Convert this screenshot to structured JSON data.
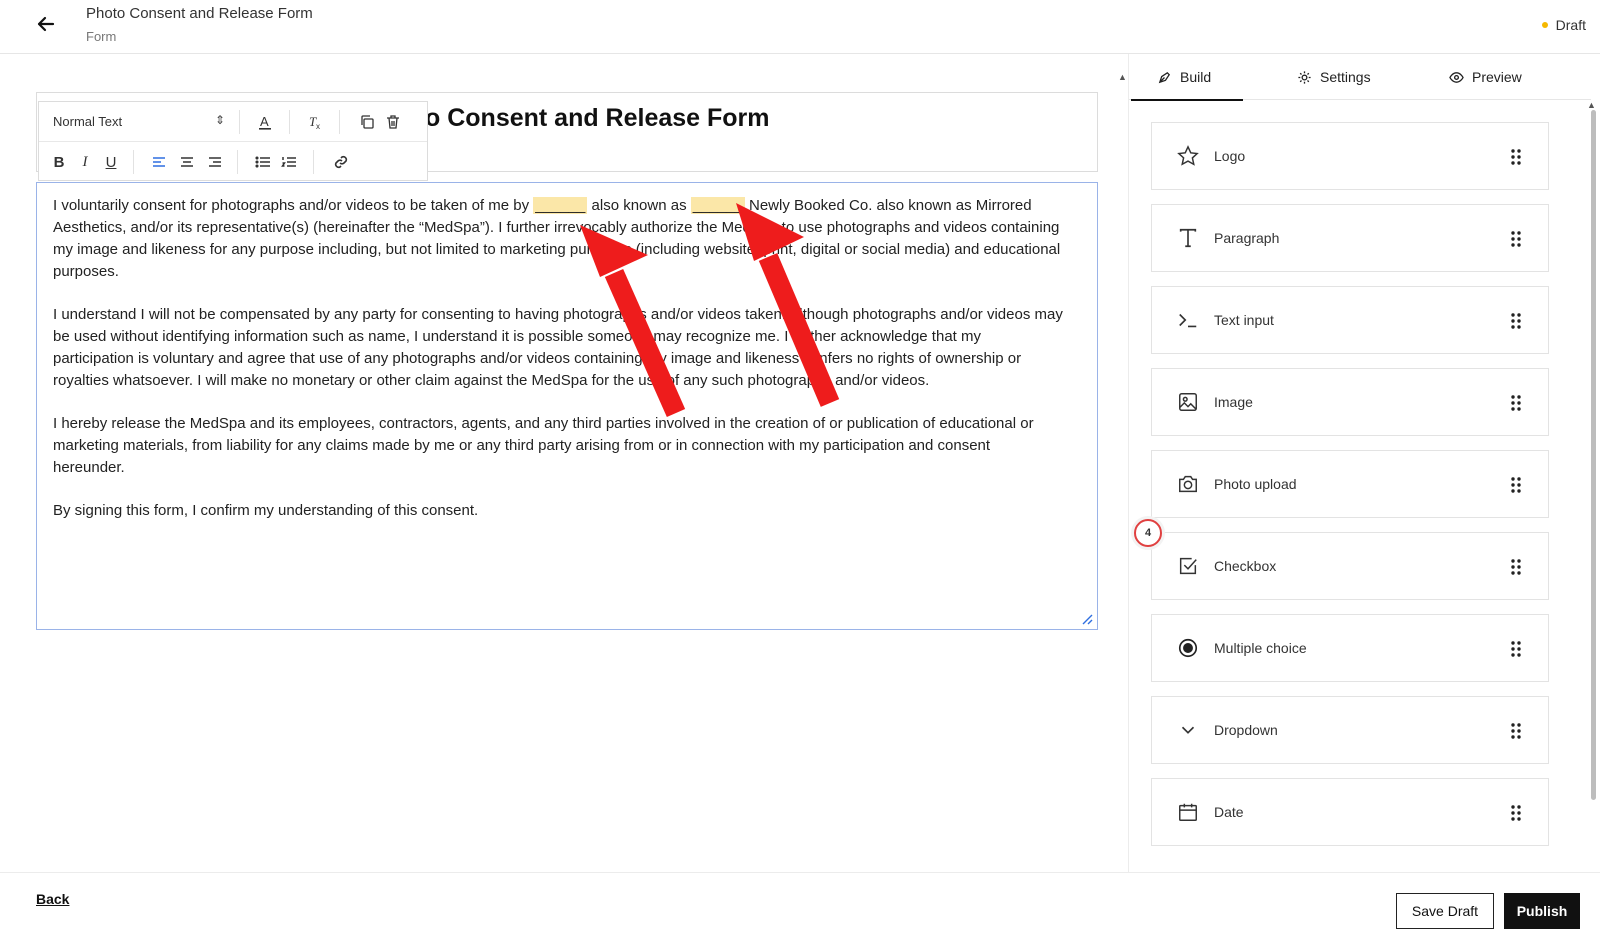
{
  "header": {
    "title": "Photo Consent and Release Form",
    "subtitle": "Form",
    "status": "Draft"
  },
  "editor": {
    "heading_visible": "o Consent and Release Form",
    "toolbar": {
      "format": "Normal Text"
    },
    "paragraphs": [
      {
        "seg1": "I voluntarily consent for photographs and/or videos to be taken of me by ",
        "blank1": "______",
        "seg2": " also known as ",
        "blank2": "______",
        "seg3": " Newly Booked Co. also known as Mirrored Aesthetics, and/or its representative(s) (hereinafter the “MedSpa”). I further irrevocably authorize the MedSpa to use photographs and videos containing my image and likeness for any purpose including, but not limited to marketing purposes (including website, print, digital or social media) and educational purposes."
      },
      {
        "text": "I understand I will not be compensated by any party for consenting to having photographs and/or videos taken. Although photographs and/or videos may be used without identifying information such as name, I understand it is possible someone may recognize me. I further acknowledge that my participation is voluntary and agree that use of any photographs and/or videos containing my image and likeness confers no rights of ownership or royalties whatsoever. I will make no monetary or other claim against the MedSpa for the use of any such photographs and/or videos."
      },
      {
        "text": "I hereby release the MedSpa and its employees, contractors, agents, and any third parties involved in the creation of or publication of educational or marketing materials, from liability for any claims made by me or any third party arising from or in connection with my participation and consent hereunder."
      },
      {
        "text": "By signing this form, I confirm my understanding of this consent."
      }
    ]
  },
  "panel": {
    "tabs": [
      {
        "label": "Build",
        "icon": "pen-icon"
      },
      {
        "label": "Settings",
        "icon": "gear-icon"
      },
      {
        "label": "Preview",
        "icon": "eye-icon"
      }
    ],
    "items": [
      {
        "label": "Logo",
        "icon": "star-icon"
      },
      {
        "label": "Paragraph",
        "icon": "text-icon"
      },
      {
        "label": "Text input",
        "icon": "terminal-icon"
      },
      {
        "label": "Image",
        "icon": "image-icon"
      },
      {
        "label": "Photo upload",
        "icon": "camera-icon"
      },
      {
        "label": "Checkbox",
        "icon": "checkbox-icon"
      },
      {
        "label": "Multiple choice",
        "icon": "radio-icon"
      },
      {
        "label": "Dropdown",
        "icon": "chevron-down-icon"
      },
      {
        "label": "Date",
        "icon": "calendar-icon"
      }
    ],
    "badge": "4"
  },
  "footer": {
    "back": "Back",
    "save": "Save Draft",
    "publish": "Publish"
  },
  "colors": {
    "accent": "#2f6fe0",
    "highlight": "#fbe7a8",
    "arrow": "#ee1c1c",
    "draft": "#f5b800"
  }
}
